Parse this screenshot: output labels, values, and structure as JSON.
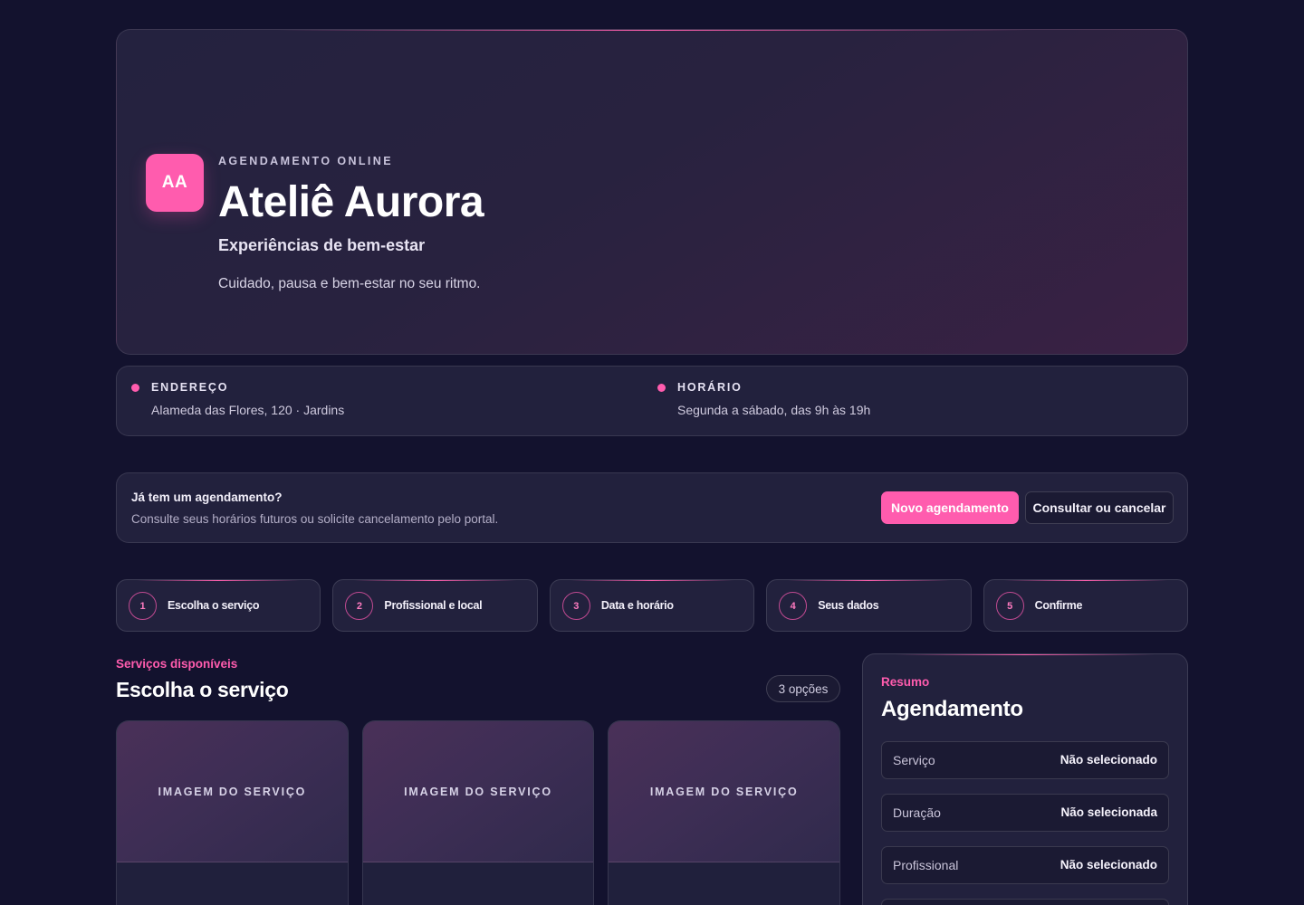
{
  "colors": {
    "accent": "#ff5cae",
    "background": "#13122e",
    "panel": "#22213d"
  },
  "hero": {
    "logo_text": "AA",
    "eyebrow": "AGENDAMENTO ONLINE",
    "title": "Ateliê Aurora",
    "subtitle": "Experiências de bem-estar",
    "description": "Cuidado, pausa e bem-estar no seu ritmo."
  },
  "info": {
    "address": {
      "label": "ENDEREÇO",
      "value": "Alameda das Flores, 120 · Jardins"
    },
    "hours": {
      "label": "HORÁRIO",
      "value": "Segunda a sábado, das 9h às 19h"
    }
  },
  "existing": {
    "title": "Já tem um agendamento?",
    "description": "Consulte seus horários futuros ou solicite cancelamento pelo portal.",
    "new_button": "Novo agendamento",
    "lookup_button": "Consultar ou cancelar"
  },
  "steps": [
    {
      "number": "1",
      "label": "Escolha o serviço"
    },
    {
      "number": "2",
      "label": "Profissional e local"
    },
    {
      "number": "3",
      "label": "Data e horário"
    },
    {
      "number": "4",
      "label": "Seus dados"
    },
    {
      "number": "5",
      "label": "Confirme"
    }
  ],
  "services": {
    "eyebrow": "Serviços disponíveis",
    "title": "Escolha o serviço",
    "count": "3 opções",
    "cards": [
      {
        "image_label": "IMAGEM DO SERVIÇO"
      },
      {
        "image_label": "IMAGEM DO SERVIÇO"
      },
      {
        "image_label": "IMAGEM DO SERVIÇO"
      }
    ]
  },
  "summary": {
    "eyebrow": "Resumo",
    "title": "Agendamento",
    "rows": [
      {
        "key": "Serviço",
        "value": "Não selecionado"
      },
      {
        "key": "Duração",
        "value": "Não selecionada"
      },
      {
        "key": "Profissional",
        "value": "Não selecionado"
      }
    ]
  }
}
